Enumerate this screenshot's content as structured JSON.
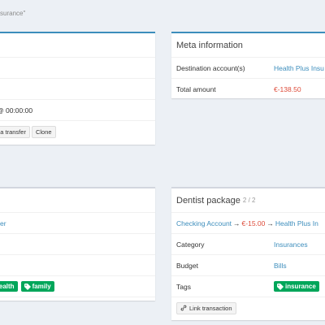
{
  "breadcrumb": "surance\"",
  "left_top": {
    "time_value": "@ 00:00:00",
    "buttons": [
      "o a transfer",
      "Clone"
    ]
  },
  "meta": {
    "title": "Meta information",
    "rows": [
      {
        "key": "Destination account(s)",
        "value": "Health Plus Insu"
      },
      {
        "key": "Total amount",
        "value": "€-138.50"
      }
    ]
  },
  "left_bottom": {
    "link_text": "er",
    "tags": [
      "health",
      "family"
    ]
  },
  "dentist": {
    "title": "Dentist package",
    "counter": "2 / 2",
    "transfer": {
      "from": "Checking Account",
      "arrow": "→",
      "amount": "€-15.00",
      "to": "Health Plus In"
    },
    "rows": [
      {
        "key": "Category",
        "value": "Insurances"
      },
      {
        "key": "Budget",
        "value": "Bills"
      },
      {
        "key": "Tags",
        "value": "insurance"
      }
    ],
    "link_button": "Link transaction"
  },
  "colors": {
    "accent": "#3c8dbc",
    "tag": "#00a65a",
    "negative": "#dd4b39"
  },
  "icons": [
    "tag-icon",
    "link-icon"
  ]
}
